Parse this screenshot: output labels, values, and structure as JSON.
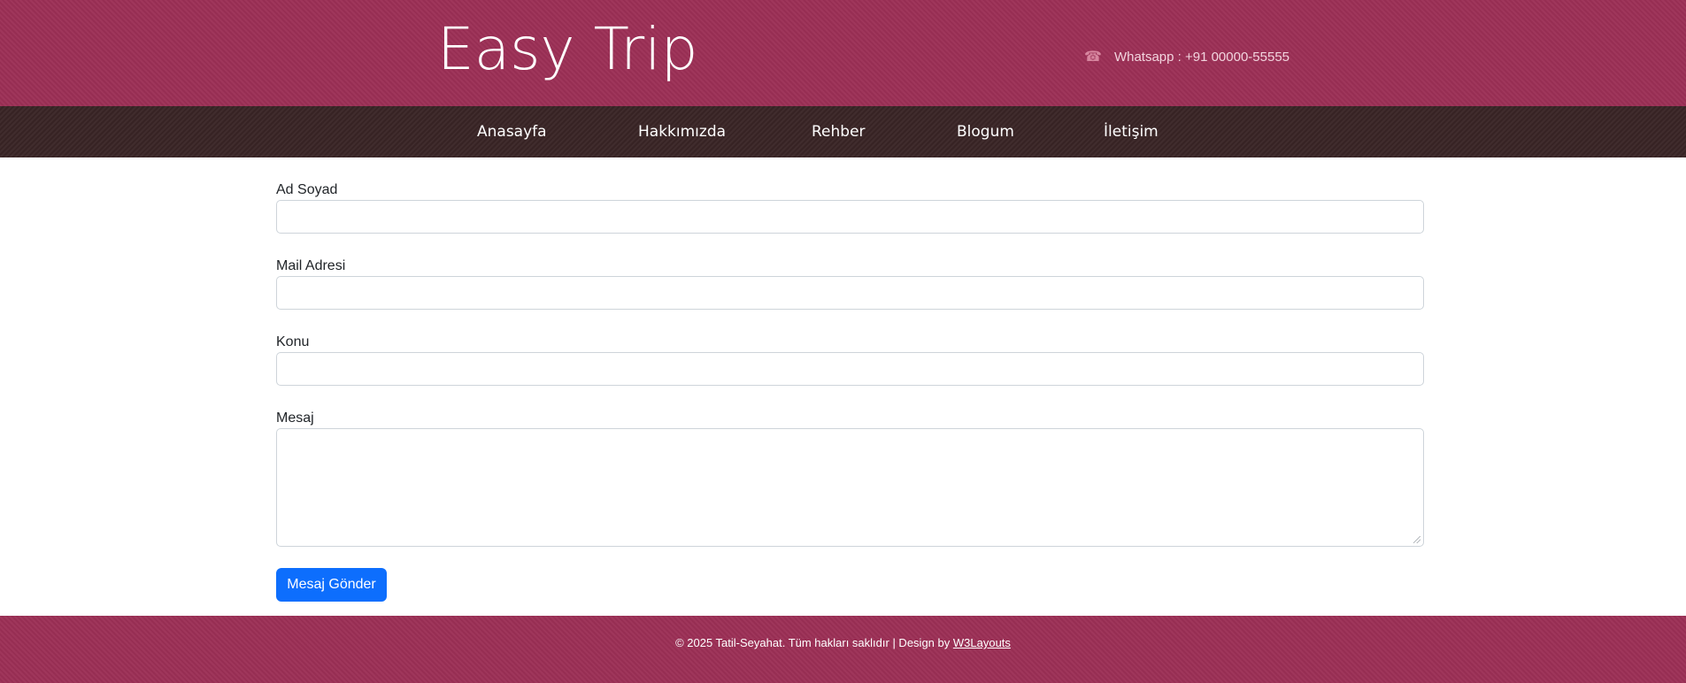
{
  "header": {
    "logo": "Easy Trip",
    "contact": {
      "icon": "phone-icon",
      "text": "Whatsapp : +91 00000-55555"
    }
  },
  "nav": {
    "items": [
      {
        "label": "Anasayfa"
      },
      {
        "label": "Hakkımızda"
      },
      {
        "label": "Rehber"
      },
      {
        "label": "Blogum"
      },
      {
        "label": "İletişim"
      }
    ]
  },
  "form": {
    "name_label": "Ad Soyad",
    "name_value": "",
    "mail_label": "Mail Adresi",
    "mail_value": "",
    "subject_label": "Konu",
    "subject_value": "",
    "message_label": "Mesaj",
    "message_value": "",
    "submit_label": "Mesaj Gönder"
  },
  "footer": {
    "text": "© 2025 Tatil-Seyahat. Tüm hakları saklıdır | Design by",
    "link": "W3Layouts"
  },
  "colors": {
    "header_bg": "#9c2f56",
    "nav_bg": "#3a2526",
    "button_bg": "#0d6efd"
  }
}
